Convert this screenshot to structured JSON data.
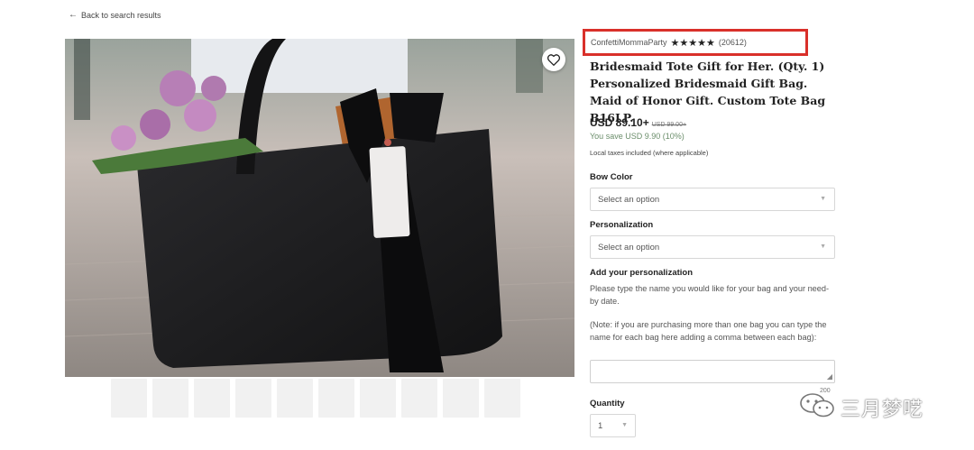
{
  "nav": {
    "back_label": "Back to search results",
    "back_icon": "arrow-left-icon"
  },
  "product": {
    "shop_name": "ConfettiMommaParty",
    "rating_stars": "★★★★★",
    "rating_value": 5,
    "review_count": "(20612)",
    "title": "Bridesmaid Tote Gift for Her. (Qty. 1) Personalized Bridesmaid Gift Bag. Maid of Honor Gift. Custom Tote Bag B16LP.",
    "price": "USD 89.10+",
    "original_price": "USD 99.00+",
    "savings": "You save USD 9.90 (10%)",
    "taxes_note": "Local taxes included (where applicable)"
  },
  "options": {
    "bow_color": {
      "label": "Bow Color",
      "value": "Select an option"
    },
    "personalization": {
      "label": "Personalization",
      "value": "Select an option"
    }
  },
  "add_personalization": {
    "label": "Add your personalization",
    "help_1": "Please type the name you would like for your bag and your need-by date.",
    "help_2": "(Note: if you are purchasing more than one bag you can type the name for each bag here adding a comma between each bag):",
    "counter": "200"
  },
  "quantity": {
    "label": "Quantity",
    "value": "1"
  },
  "watermark": {
    "text": "三月梦呓"
  },
  "colors": {
    "highlight_border": "#d9302a",
    "savings_green": "#6b8e6b",
    "bag": "#1b1b1d"
  }
}
